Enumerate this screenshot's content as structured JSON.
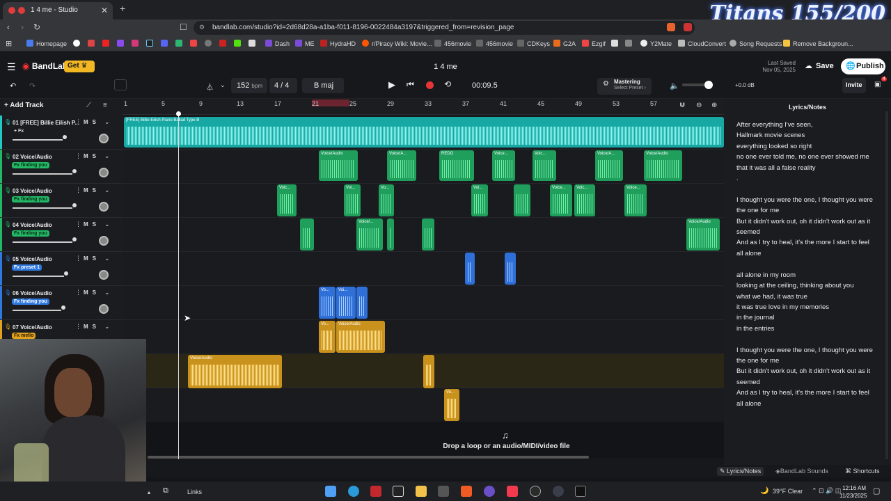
{
  "browser": {
    "tab_title": "1 4 me - Studio",
    "url": "bandlab.com/studio?id=2d68d28a-a1ba-f011-8196-0022484a3197&triggered_from=revision_page",
    "bookmarks": [
      "Homepage",
      "Dash",
      "ME",
      "HydraHD",
      "r/Piracy Wiki: Movie...",
      "456movie",
      "456movie",
      "CDKeys",
      "G2A",
      "Ezgif",
      "Y2Mate",
      "CloudConvert",
      "Song Requests",
      "Remove Backgroun..."
    ]
  },
  "overlay": {
    "stream_counter": "Titans 155/200"
  },
  "header": {
    "logo": "BandLab",
    "get": "Get",
    "project_title": "1 4 me",
    "last_saved_label": "Last Saved",
    "last_saved_date": "Nov 05, 2025",
    "save": "Save",
    "publish": "Publish"
  },
  "toolbar": {
    "bpm_value": "152",
    "bpm_unit": "bpm",
    "time_sig": "4 / 4",
    "key": "B maj",
    "time": "00:09.5",
    "mastering": "Mastering",
    "select_preset": "Select Preset ›",
    "volume_db": "+0.0 dB",
    "invite": "Invite",
    "notif_count": "4"
  },
  "ruler": {
    "ticks": [
      "1",
      "5",
      "9",
      "13",
      "17",
      "21",
      "25",
      "29",
      "33",
      "37",
      "41",
      "45",
      "49",
      "53",
      "57"
    ]
  },
  "tracks_header": {
    "add_track": "Add Track"
  },
  "tracks": [
    {
      "name": "01  [FREE] Billie Eilish P...",
      "fx": "+ Fx",
      "fx_bg": "transparent",
      "fx_color": "#ddd",
      "color": "#22c8c4"
    },
    {
      "name": "02  Voice/Audio",
      "fx": "Fx  finding you",
      "fx_bg": "#22b866",
      "fx_color": "#0a2a16",
      "color": "#22b866"
    },
    {
      "name": "03  Voice/Audio",
      "fx": "Fx  finding you",
      "fx_bg": "#22b866",
      "fx_color": "#0a2a16",
      "color": "#22b866"
    },
    {
      "name": "04  Voice/Audio",
      "fx": "Fx  finding you",
      "fx_bg": "#22b866",
      "fx_color": "#0a2a16",
      "color": "#22b866"
    },
    {
      "name": "05  Voice/Audio",
      "fx": "Fx  preset 1",
      "fx_bg": "#2f78e0",
      "fx_color": "#fff",
      "color": "#2f78e0"
    },
    {
      "name": "06  Voice/Audio",
      "fx": "Fx  finding you",
      "fx_bg": "#2f78e0",
      "fx_color": "#fff",
      "color": "#2f78e0"
    },
    {
      "name": "07  Voice/Audio",
      "fx": "Fx  mello",
      "fx_bg": "#e0a21e",
      "fx_color": "#2a1a00",
      "color": "#e0a21e"
    }
  ],
  "clips": {
    "beat_label": "[FREE] Billie Eilish Piano Ballad Type B",
    "voice": "Voice/Audio",
    "voiceA": "Voice/A...",
    "redo": "REDO",
    "voice_dots": "Voice...",
    "voic": "Voic...",
    "vo": "Vo...",
    "voi": "Voi...",
    "voice_slash": "Voice/..."
  },
  "drop": {
    "text": "Drop a loop or an audio/MIDI/video file"
  },
  "lyrics": {
    "title": "Lyrics/Notes",
    "text": "After everything I've seen,\nHallmark movie scenes\neverything looked so right\nno one ever told me, no one ever showed me\nthat it was all a false reality\n.\n\nI thought you were the one, I thought you were the one for me\nBut it didn't work out, oh it didn't work out as it seemed\nAnd as I try to heal, it's the more I start to feel all alone\n\nall alone in my room\nlooking at the ceiling, thinking about you\nwhat we had, it was true\nit was true love in my memories\nin the journal\nin the entries\n\nI thought you were the one, I thought you were the one for me\nBut it didn't work out, oh it didn't work out as it seemed\nAnd as I try to heal, it's the more I start to feel all alone"
  },
  "bottom": {
    "lyrics_notes": "Lyrics/Notes",
    "sounds": "BandLab Sounds",
    "shortcuts": "Shortcuts"
  },
  "taskbar": {
    "links": "Links",
    "weather": "39°F  Clear",
    "time": "12:16 AM",
    "date": "11/23/2025"
  }
}
